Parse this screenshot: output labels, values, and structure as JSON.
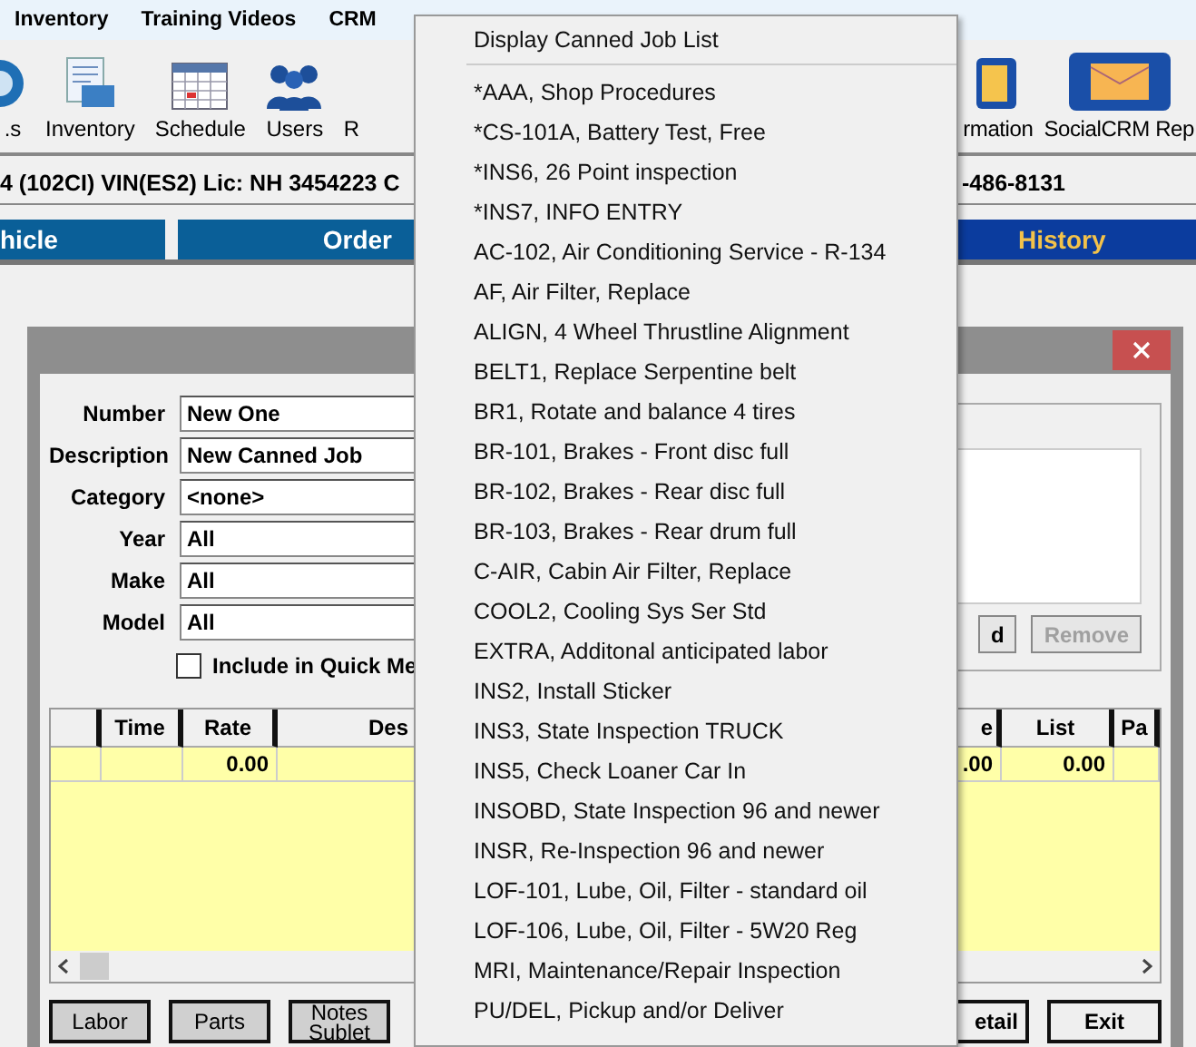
{
  "menubar": [
    "Inventory",
    "Training Videos",
    "CRM"
  ],
  "toolbar": {
    "left": [
      {
        "label": ".s"
      },
      {
        "label": "Inventory"
      },
      {
        "label": "Schedule"
      },
      {
        "label": "Users"
      },
      {
        "label": "R"
      }
    ],
    "right": [
      {
        "label": "rmation"
      },
      {
        "label": "SocialCRM Rep"
      }
    ]
  },
  "vehicle_line": {
    "left": "4 (102CI) VIN(ES2) Lic: NH 3454223  C",
    "right": "-486-8131"
  },
  "tabs": [
    {
      "label": "hicle",
      "selected": false
    },
    {
      "label": "Order",
      "selected": false
    },
    {
      "label": "History",
      "selected": true
    }
  ],
  "dialog": {
    "fields": [
      {
        "label": "Number",
        "value": "New One"
      },
      {
        "label": "Description",
        "value": "New Canned Job"
      },
      {
        "label": "Category",
        "value": "<none>"
      },
      {
        "label": "Year",
        "value": "All"
      },
      {
        "label": "Make",
        "value": "All"
      },
      {
        "label": "Model",
        "value": "All"
      }
    ],
    "quick_menu": {
      "label": "Include in Quick Me",
      "checked": false
    },
    "add_button": {
      "label": "d",
      "disabled": false
    },
    "remove_button": {
      "label": "Remove",
      "disabled": true
    },
    "grid": {
      "columns": [
        "Time",
        "Rate",
        "Des",
        "e",
        "List",
        "Pa"
      ],
      "rows": [
        {
          "rate": "0.00",
          "column_5": ".00",
          "list": "0.00"
        }
      ]
    },
    "left_buttons": [
      "Labor",
      "Parts",
      "Notes\nSublet"
    ],
    "right_buttons": [
      "etail",
      "Exit"
    ]
  },
  "popup_menu": {
    "header": "Display Canned Job List",
    "items": [
      "*AAA, Shop Procedures",
      "*CS-101A, Battery Test, Free",
      "*INS6, 26 Point inspection",
      "*INS7, INFO ENTRY",
      "AC-102, Air Conditioning Service - R-134",
      "AF, Air Filter, Replace",
      "ALIGN, 4 Wheel Thrustline Alignment",
      "BELT1, Replace Serpentine belt",
      "BR1, Rotate and balance 4 tires",
      "BR-101, Brakes - Front disc full",
      "BR-102, Brakes - Rear disc full",
      "BR-103, Brakes - Rear drum full",
      "C-AIR, Cabin Air Filter, Replace",
      "COOL2, Cooling Sys Ser Std",
      "EXTRA, Additonal anticipated labor",
      "INS2, Install Sticker",
      "INS3, State Inspection TRUCK",
      "INS5, Check Loaner Car In",
      "INSOBD, State Inspection 96 and newer",
      "INSR, Re-Inspection 96 and newer",
      "LOF-101, Lube, Oil, Filter - standard oil",
      "LOF-106, Lube, Oil, Filter - 5W20 Reg",
      "MRI, Maintenance/Repair Inspection",
      "PU/DEL, Pickup and/or Deliver"
    ]
  }
}
